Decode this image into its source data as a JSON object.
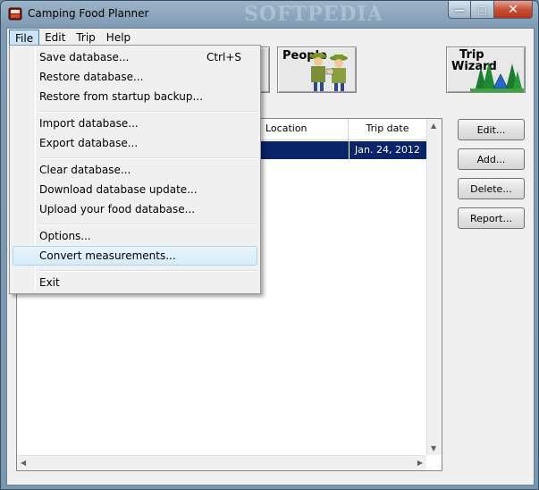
{
  "window": {
    "title": "Camping Food Planner",
    "watermark": "SOFTPEDIA"
  },
  "menubar": [
    "File",
    "Edit",
    "Trip",
    "Help"
  ],
  "toolbar": {
    "people_label": "People",
    "wizard_label_line1": "Trip",
    "wizard_label_line2": "Wizard"
  },
  "file_menu": {
    "group1": [
      {
        "label": "Save database...",
        "shortcut": "Ctrl+S"
      },
      {
        "label": "Restore database...",
        "shortcut": ""
      },
      {
        "label": "Restore from startup backup...",
        "shortcut": ""
      }
    ],
    "group2": [
      {
        "label": "Import database..."
      },
      {
        "label": "Export database..."
      }
    ],
    "group3": [
      {
        "label": "Clear database..."
      },
      {
        "label": "Download database update..."
      },
      {
        "label": "Upload your food database..."
      }
    ],
    "group4": [
      {
        "label": "Options..."
      },
      {
        "label": "Convert measurements..."
      }
    ],
    "group5": [
      {
        "label": "Exit"
      }
    ]
  },
  "trips_table": {
    "columns": [
      "Location",
      "Trip date"
    ],
    "rows": [
      {
        "location": "",
        "trip_date": "Jan. 24, 2012"
      }
    ]
  },
  "side_buttons": [
    "Edit...",
    "Add...",
    "Delete...",
    "Report..."
  ],
  "colors": {
    "selection": "#0a246a",
    "menu_highlight": "#d7ecf8"
  }
}
